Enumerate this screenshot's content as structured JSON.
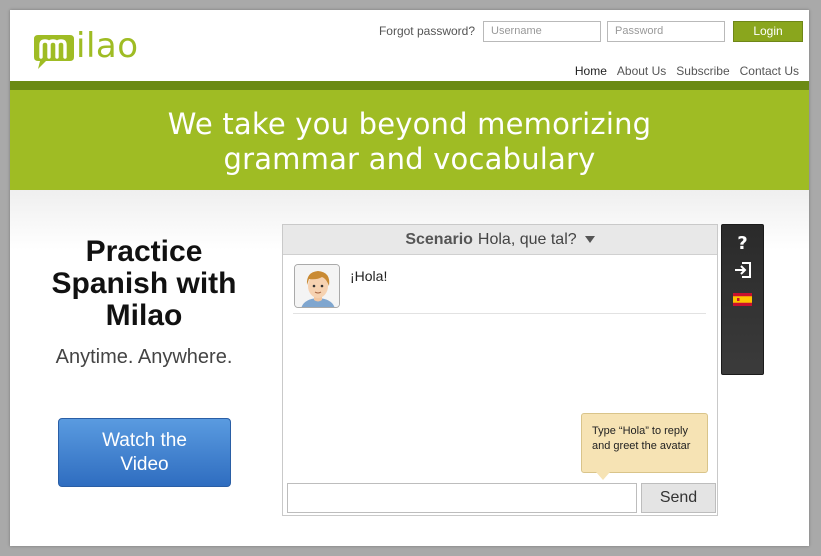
{
  "brand": {
    "logo_text": "ilao",
    "colors": {
      "accent": "#9fbc24",
      "accent_dark": "#6b8a14",
      "button_blue": "#2f6dc0"
    }
  },
  "login": {
    "forgot_label": "Forgot password?",
    "username_placeholder": "Username",
    "password_placeholder": "Password",
    "login_label": "Login"
  },
  "nav": {
    "items": [
      {
        "label": "Home",
        "active": true
      },
      {
        "label": "About Us"
      },
      {
        "label": "Subscribe"
      },
      {
        "label": "Contact Us"
      }
    ]
  },
  "banner": {
    "line1": "We take you beyond memorizing",
    "line2": "grammar and vocabulary"
  },
  "hero": {
    "headline": "Practice Spanish with Milao",
    "tagline": "Anytime. Anywhere.",
    "video_button_label": "Watch the Video"
  },
  "chat": {
    "scenario_label": "Scenario",
    "scenario_value": "Hola, que tal?",
    "messages": [
      {
        "speaker": "avatar",
        "text": "¡Hola!"
      }
    ],
    "tooltip": "Type “Hola” to reply and greet the avatar",
    "input_value": "",
    "send_label": "Send"
  },
  "sidebar": {
    "icons": [
      "help-icon",
      "login-icon",
      "spain-flag-icon"
    ],
    "help_glyph": "?"
  }
}
